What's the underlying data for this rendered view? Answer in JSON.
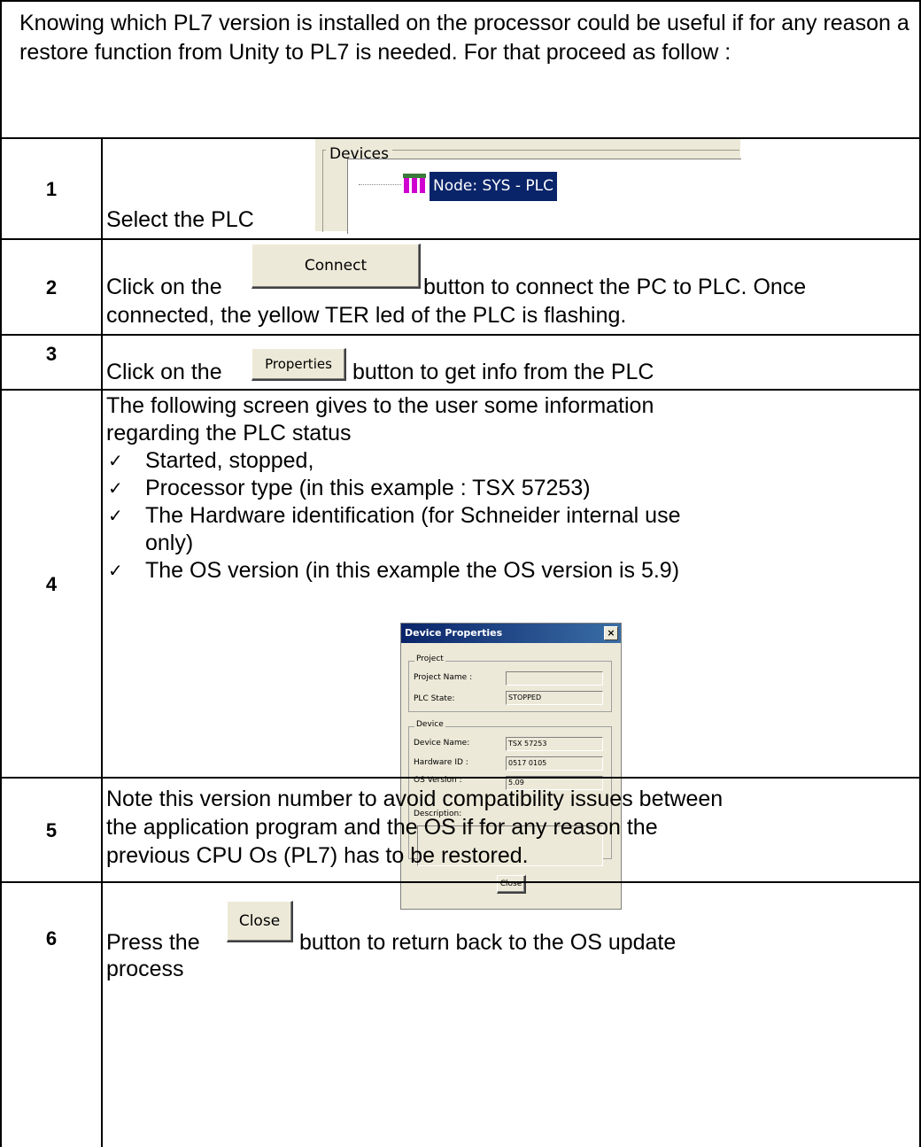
{
  "intro": "Knowing which PL7 version is installed on the processor could be useful if for any reason a restore function from Unity to PL7 is needed. For that proceed as follow :",
  "steps": [
    {
      "num": "1",
      "text": "Select the PLC"
    },
    {
      "num": "2",
      "text_before": "Click on the",
      "text_after": "button to connect the PC to PLC. Once",
      "text_line2": "connected, the yellow TER led of the PLC is flashing."
    },
    {
      "num": "3",
      "text_before": "Click on the",
      "text_after": "button to get info from the PLC"
    },
    {
      "num": "4",
      "line1": "The following screen gives to the user some information",
      "line2": "regarding the PLC status",
      "checks": [
        "Started, stopped,",
        "Processor type (in this example : TSX 57253)",
        "The Hardware identification (for Schneider internal use",
        "only)",
        "The OS version (in this example the OS version is 5.9)"
      ]
    },
    {
      "num": "5",
      "lines": [
        "Note this version number to avoid compatibility issues between",
        "the application program and the OS if for any reason the",
        "previous CPU Os (PL7) has to be restored."
      ]
    },
    {
      "num": "6",
      "text_before": "Press the",
      "text_after": "button to return back to the OS update",
      "text_line2": "process"
    }
  ],
  "devices_panel": {
    "legend": "Devices",
    "node_label": "Node: SYS - PLC"
  },
  "buttons": {
    "connect": "Connect",
    "properties": "Properties",
    "close": "Close"
  },
  "dialog": {
    "title": "Device Properties",
    "close_x": "×",
    "project_group": "Project",
    "project_name_label": "Project Name :",
    "project_name_value": "",
    "plc_state_label": "PLC State:",
    "plc_state_value": "STOPPED",
    "device_group": "Device",
    "device_name_label": "Device Name:",
    "device_name_value": "TSX 57253",
    "hardware_id_label": "Hardware ID :",
    "hardware_id_value": "0517 0105",
    "os_version_label": "OS Version :",
    "os_version_value": "5.09",
    "description_label": "Description:",
    "close_button": "Close"
  },
  "check_glyph": "✓"
}
